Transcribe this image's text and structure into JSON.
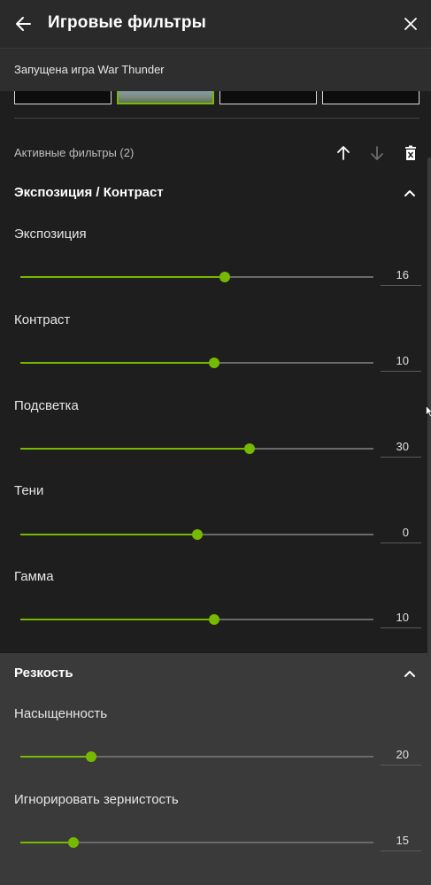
{
  "header": {
    "title": "Игровые фильтры",
    "back_icon": "arrow-left-icon",
    "close_icon": "close-icon"
  },
  "game_bar": {
    "text": "Запущена игра War Thunder"
  },
  "filters_header": {
    "label": "Активные фильтры (2)",
    "move_up_icon": "arrow-up-icon",
    "move_down_icon": "arrow-down-icon",
    "delete_icon": "trash-icon"
  },
  "colors": {
    "accent": "#76b900",
    "background": "#1e1e1e",
    "section2_bg": "#3a3a3a"
  },
  "sections": [
    {
      "title": "Экспозиция / Контраст",
      "params": [
        {
          "label": "Экспозиция",
          "value": "16",
          "level": 0.58
        },
        {
          "label": "Контраст",
          "value": "10",
          "level": 0.55
        },
        {
          "label": "Подсветка",
          "value": "30",
          "level": 0.65
        },
        {
          "label": "Тени",
          "value": "0",
          "level": 0.5
        },
        {
          "label": "Гамма",
          "value": "10",
          "level": 0.55
        }
      ]
    },
    {
      "title": "Резкость",
      "params": [
        {
          "label": "Насыщенность",
          "value": "20",
          "level": 0.2
        },
        {
          "label": "Игнорировать зернистость",
          "value": "15",
          "level": 0.15
        }
      ]
    }
  ]
}
